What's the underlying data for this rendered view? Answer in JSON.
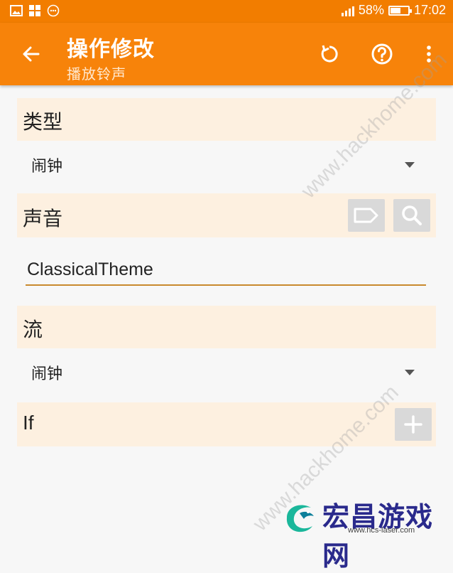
{
  "status_bar": {
    "battery": "58%",
    "battery_level": 0.58,
    "time": "17:02",
    "icons": [
      "image-icon",
      "apps-icon",
      "message-icon",
      "signal-icon",
      "battery-icon"
    ]
  },
  "app_bar": {
    "title": "操作修改",
    "subtitle": "播放铃声",
    "icons": [
      "back-arrow-icon",
      "reset-icon",
      "help-icon",
      "more-vert-icon"
    ]
  },
  "sections": {
    "type": {
      "label": "类型",
      "value": "闹钟"
    },
    "sound": {
      "label": "声音",
      "value": "ClassicalTheme",
      "icons": [
        "tag-icon",
        "search-icon"
      ]
    },
    "stream": {
      "label": "流",
      "value": "闹钟"
    },
    "if": {
      "label": "If",
      "icons": [
        "plus-icon"
      ]
    }
  },
  "watermark": {
    "text_top": "www.hackhome.com",
    "text_bottom": "www.hackhome.com",
    "logo_text": "宏昌游戏网",
    "logo_sub": "www.hcs-laser.com"
  },
  "colors": {
    "accent": "#f7830a",
    "section_bg": "#fdf0e0",
    "input_underline": "#c8892e",
    "button_bg": "#d9d9d9"
  }
}
